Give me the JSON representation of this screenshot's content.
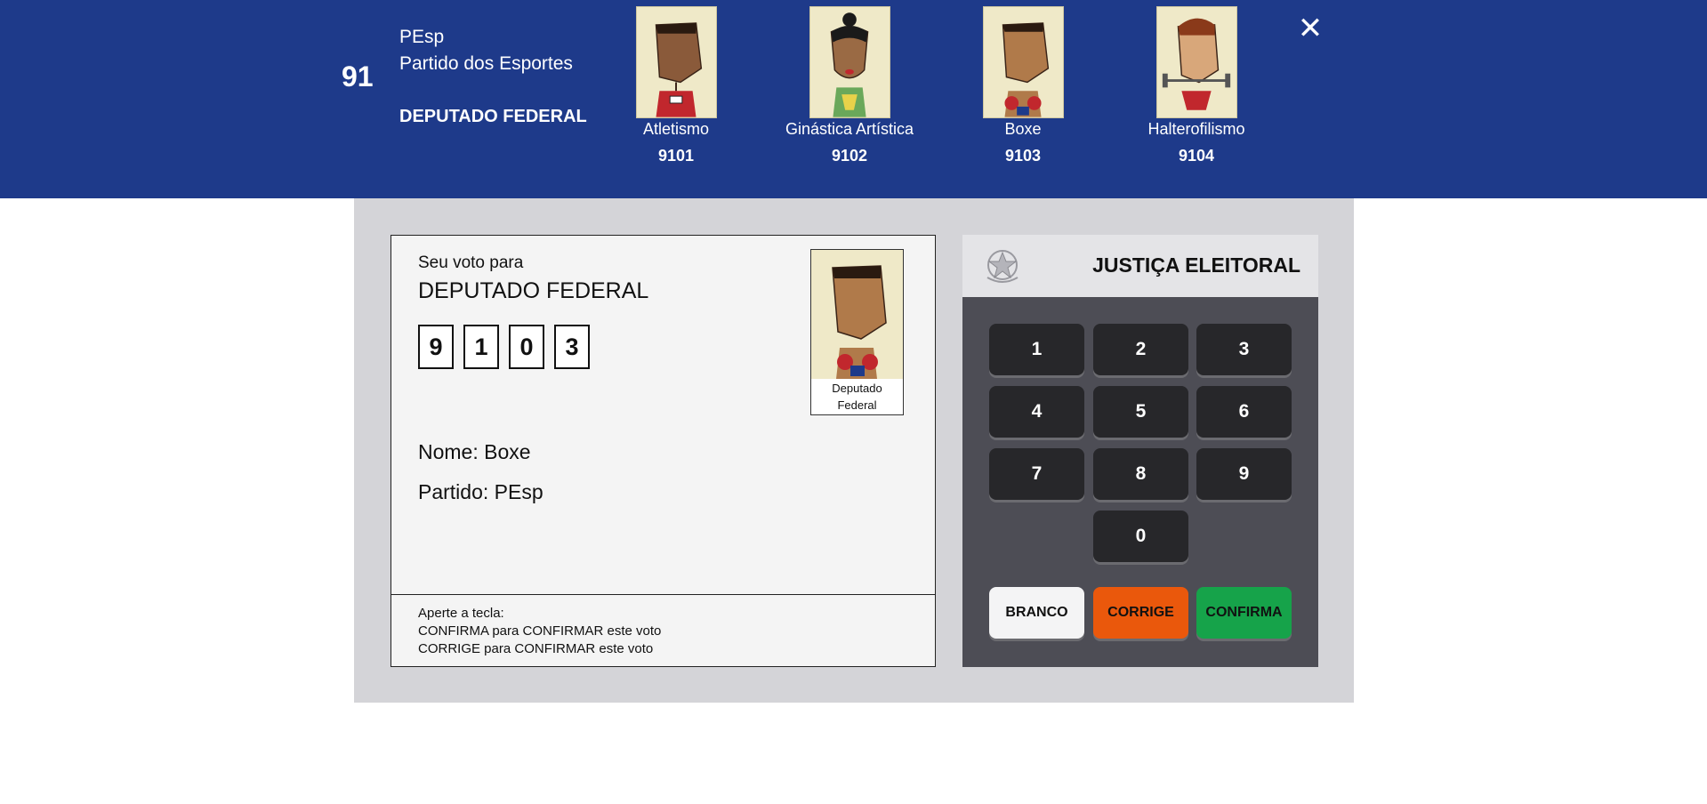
{
  "header": {
    "party_number": "91",
    "party_abbr": "PEsp",
    "party_name": "Partido dos Esportes",
    "office": "DEPUTADO FEDERAL",
    "close_symbol": "✕",
    "candidates": [
      {
        "name": "Atletismo",
        "number": "9101",
        "shirt": "#c1272d"
      },
      {
        "name": "Ginástica Artística",
        "number": "9102",
        "shirt": "#5a9a4a"
      },
      {
        "name": "Boxe",
        "number": "9103",
        "shirt": "#b07a4a"
      },
      {
        "name": "Halterofilismo",
        "number": "9104",
        "shirt": "#c1272d"
      }
    ]
  },
  "screen": {
    "vote_for_label": "Seu voto para",
    "office": "DEPUTADO FEDERAL",
    "digits": [
      "9",
      "1",
      "0",
      "3"
    ],
    "photo_caption_line1": "Deputado",
    "photo_caption_line2": "Federal",
    "name_line": "Nome: Boxe",
    "party_line": "Partido:  PEsp",
    "instructions": [
      "Aperte a tecla:",
      "CONFIRMA para CONFIRMAR este voto",
      "CORRIGE para CONFIRMAR este voto"
    ]
  },
  "keypad": {
    "title": "JUSTIÇA ELEITORAL",
    "keys": [
      "1",
      "2",
      "3",
      "4",
      "5",
      "6",
      "7",
      "8",
      "9",
      "0"
    ],
    "branco": "BRANCO",
    "corrige": "CORRIGE",
    "confirma": "CONFIRMA"
  },
  "colors": {
    "header_bg": "#1e3a8a",
    "branco": "#f4f4f5",
    "corrige": "#ea580c",
    "confirma": "#16a34a"
  }
}
